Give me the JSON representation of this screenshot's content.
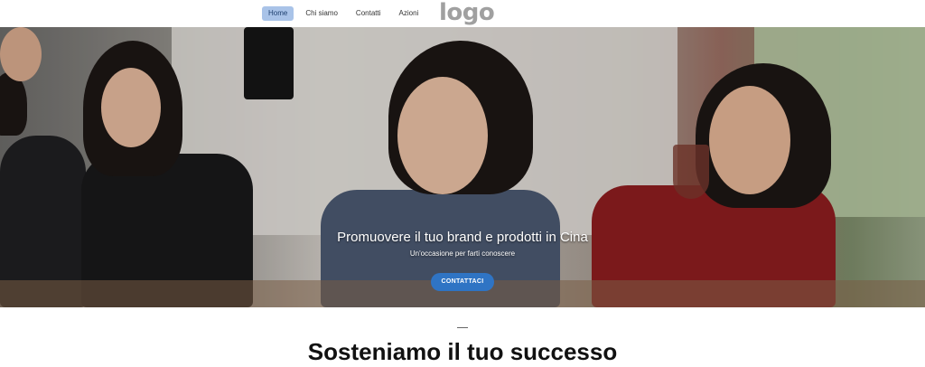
{
  "nav": {
    "items": [
      {
        "label": "Home",
        "active": true
      },
      {
        "label": "Chi siamo",
        "active": false
      },
      {
        "label": "Contatti",
        "active": false
      },
      {
        "label": "Azioni",
        "active": false
      }
    ]
  },
  "logo": {
    "text": "logo"
  },
  "hero": {
    "title": "Promuovere il tuo brand e prodotti in Cina",
    "subtitle": "Un'occasione per farti conoscere",
    "cta_label": "CONTATTACI"
  },
  "section": {
    "title": "Sosteniamo il tuo successo"
  },
  "colors": {
    "accent": "#2f74c4",
    "nav_active": "#a9c3e8"
  }
}
